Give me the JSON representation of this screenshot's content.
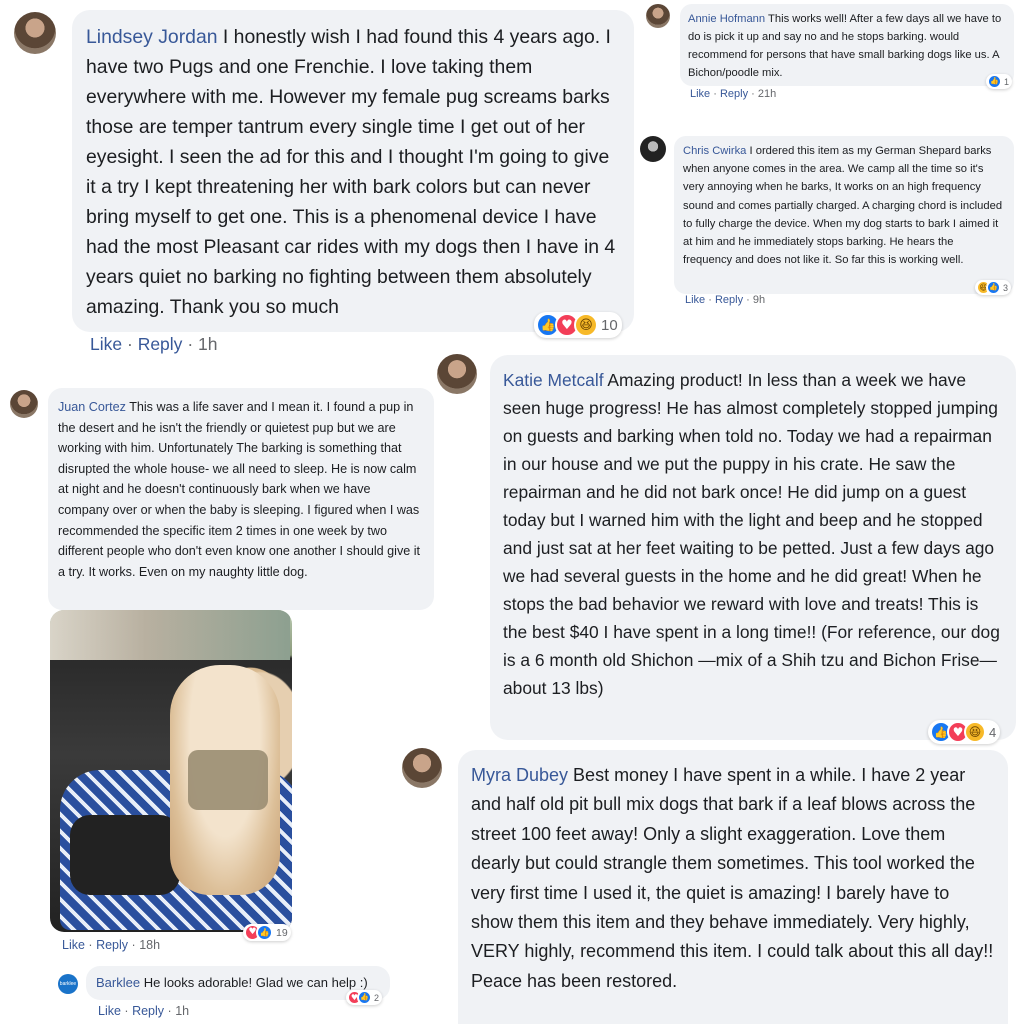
{
  "comments": {
    "lindsey": {
      "name": "Lindsey Jordan",
      "text": "I honestly wish I had found this 4 years ago. I have two Pugs and one Frenchie. I love taking them everywhere with me. However my female pug screams barks those are temper tantrum every single time I get out of her eyesight. I seen the ad for this and I thought I'm going to give it a try I kept threatening her with bark colors but can never bring myself to get one. This is a phenomenal device I have had the most Pleasant car rides with my dogs then I have in 4 years quiet no barking no fighting between them absolutely amazing. Thank you so much",
      "like": "Like",
      "reply": "Reply",
      "time": "1h",
      "reaction_count": "10"
    },
    "annie": {
      "name": "Annie Hofmann",
      "text": "This works well! After a few days all we have to do is pick it up and say no and he stops barking. would recommend for persons that have small barking dogs like us. A Bichon/poodle mix.",
      "like": "Like",
      "reply": "Reply",
      "time": "21h",
      "reaction_count": "1"
    },
    "chris": {
      "name": "Chris Cwirka",
      "text": "I ordered this item as my German Shepard barks when anyone comes in the area. We camp all the time so it's very annoying when he barks, It works on an high frequency sound and comes partially charged. A charging chord is included to fully charge the device. When my dog starts to bark I aimed it at him and he immediately stops barking. He hears the frequency and does not like it. So far this is working well.",
      "like": "Like",
      "reply": "Reply",
      "time": "9h",
      "reaction_count": "3"
    },
    "juan": {
      "name": "Juan Cortez",
      "text": "This was a life saver and I mean it. I found a pup in the desert and he isn't the friendly or quietest pup but we are working with him. Unfortunately The barking is something that disrupted the whole house- we all need to sleep. He is now calm at night and he doesn't continuously bark when we have company over or when the baby is sleeping. I figured when I was recommended the specific item 2 times in one week by two different people who don't even know one another I should give it a try. It works. Even on my naughty little dog.",
      "like": "Like",
      "reply": "Reply",
      "time": "18h",
      "reaction_count": "19"
    },
    "barklee": {
      "name": "Barklee",
      "avatar_text": "barklee",
      "text": "He looks adorable! Glad we can help :)",
      "like": "Like",
      "reply": "Reply",
      "time": "1h",
      "reaction_count": "2"
    },
    "katie": {
      "name": "Katie Metcalf",
      "text": "Amazing product! In less than a week we have seen huge progress! He has almost completely stopped jumping on guests and barking when told no. Today we had a repairman in our house and we put the puppy in his crate. He saw the repairman and he did not bark once! He did jump on a guest today but I warned him with the light and beep and he stopped and just sat at her feet waiting to be petted. Just a few days ago we had several guests in the home and he did great! When he stops the bad behavior we reward with love and treats! This is the best $40 I have spent in a long time!! (For reference, our dog is a 6 month old Shichon —mix of a Shih tzu and Bichon Frise—about 13 lbs)",
      "reaction_count": "4"
    },
    "myra": {
      "name": "Myra Dubey",
      "text": "Best money I have spent in a while. I have 2 year and half old pit bull mix dogs that bark if a leaf blows across the street 100 feet away! Only a slight exaggeration. Love them dearly but could strangle them sometimes. This tool worked the very first time I used it, the quiet is amazing! I barely have to show them this item and they behave immediately. Very highly, VERY highly, recommend this item. I could talk about this all day!! Peace has been restored."
    }
  },
  "separator": "·",
  "icons": {
    "like": "👍",
    "love": "♥",
    "haha": "😆"
  },
  "colors": {
    "name": "#385898",
    "bubble": "#f0f2f5",
    "like": "#1877f2",
    "love": "#f33e58",
    "haha": "#f7b928"
  }
}
